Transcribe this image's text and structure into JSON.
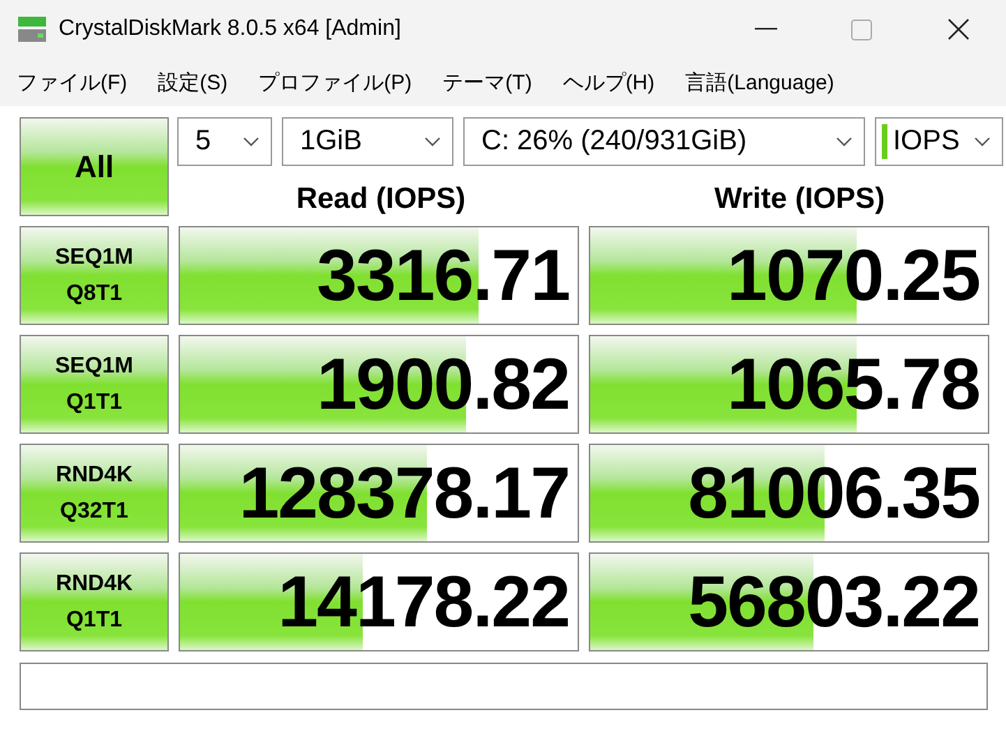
{
  "window": {
    "title": "CrystalDiskMark 8.0.5 x64 [Admin]"
  },
  "menu": [
    "ファイル(F)",
    "設定(S)",
    "プロファイル(P)",
    "テーマ(T)",
    "ヘルプ(H)",
    "言語(Language)"
  ],
  "all_button": "All",
  "selects": [
    {
      "value": "5"
    },
    {
      "value": "1GiB"
    },
    {
      "value": "C: 26% (240/931GiB)"
    },
    {
      "value": "IOPS",
      "marker": true
    }
  ],
  "headers": [
    "Read (IOPS)",
    "Write (IOPS)"
  ],
  "rows": [
    {
      "test": [
        "SEQ1M",
        "Q8T1"
      ],
      "read": {
        "value": "3316.71",
        "level": 0.75
      },
      "write": {
        "value": "1070.25",
        "level": 0.67
      }
    },
    {
      "test": [
        "SEQ1M",
        "Q1T1"
      ],
      "read": {
        "value": "1900.82",
        "level": 0.72
      },
      "write": {
        "value": "1065.78",
        "level": 0.67
      }
    },
    {
      "test": [
        "RND4K",
        "Q32T1"
      ],
      "read": {
        "value": "128378.17",
        "level": 0.62
      },
      "write": {
        "value": "81006.35",
        "level": 0.59
      }
    },
    {
      "test": [
        "RND4K",
        "Q1T1"
      ],
      "read": {
        "value": "14178.22",
        "level": 0.46
      },
      "write": {
        "value": "56803.22",
        "level": 0.56
      }
    }
  ]
}
